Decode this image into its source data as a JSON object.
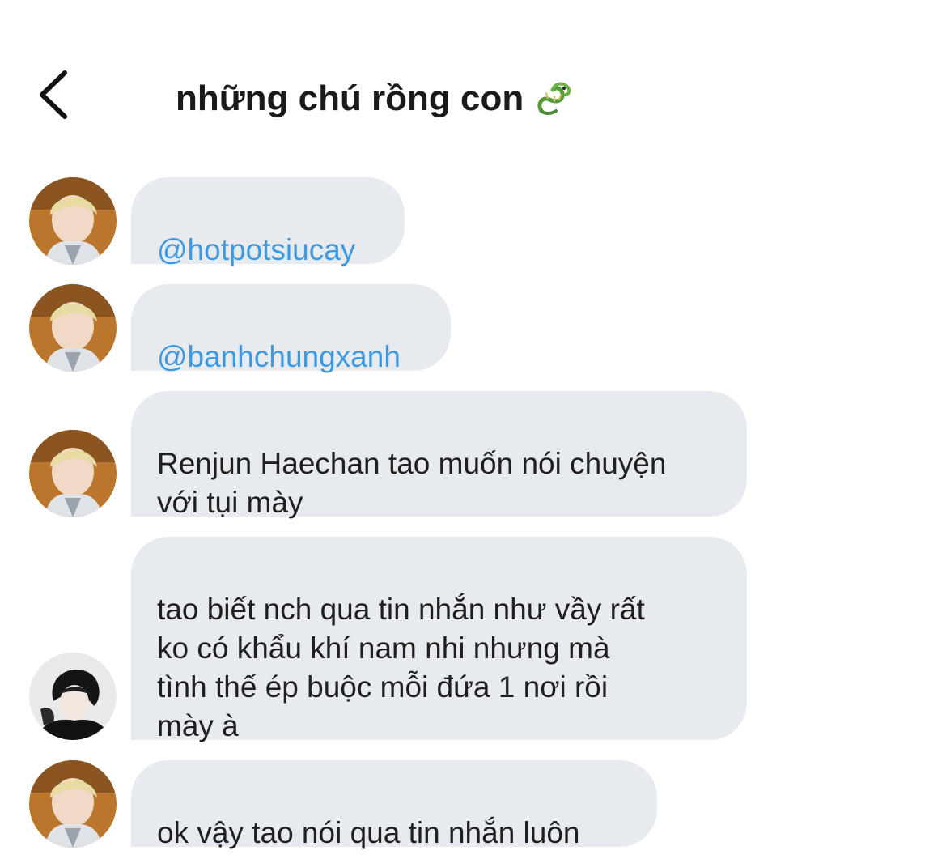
{
  "header": {
    "title": "những chú rồng con",
    "title_emoji": "dragon-emoji",
    "back_icon": "chevron-left-icon"
  },
  "colors": {
    "bubble_bg": "#e7ebef",
    "mention": "#3e9ae0",
    "text": "#1f1f1f"
  },
  "messages": [
    {
      "sender": "member-blond",
      "type": "mention",
      "text": "@hotpotsiucay"
    },
    {
      "sender": "member-blond",
      "type": "mention",
      "text": "@banhchungxanh"
    },
    {
      "sender": "member-blond",
      "type": "text",
      "text": "Renjun Haechan tao muốn nói chuyện\nvới tụi mày"
    },
    {
      "sender": "member-dark",
      "type": "text",
      "text": "tao biết nch qua tin nhắn như vầy rất\nko có khẩu khí nam nhi nhưng mà\ntình thế ép buộc mỗi đứa 1 nơi rồi\nmày à"
    },
    {
      "sender": "member-blond",
      "type": "text",
      "text": "ok vậy tao nói qua tin nhắn luôn"
    }
  ]
}
